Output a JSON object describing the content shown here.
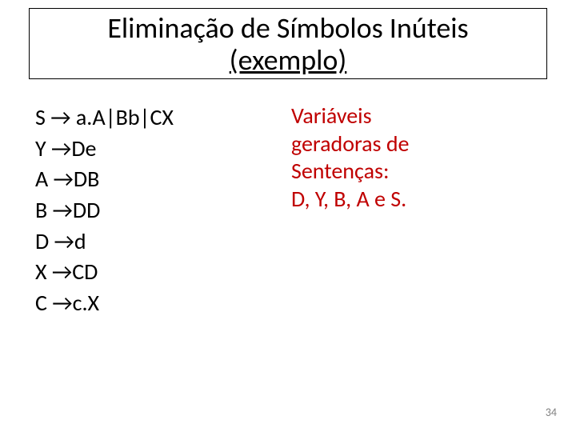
{
  "title": {
    "line1": "Eliminação de Símbolos Inúteis",
    "line2": "(exemplo)"
  },
  "grammar": {
    "rules": [
      "S → a.A|Bb|CX",
      "Y →De",
      "A →DB",
      "B →DD",
      "D →d",
      "X →CD",
      "C →c.X"
    ]
  },
  "note": {
    "lines": [
      "Variáveis",
      "geradoras de",
      "Sentenças:",
      "D, Y, B, A e S."
    ]
  },
  "page_number": "34"
}
